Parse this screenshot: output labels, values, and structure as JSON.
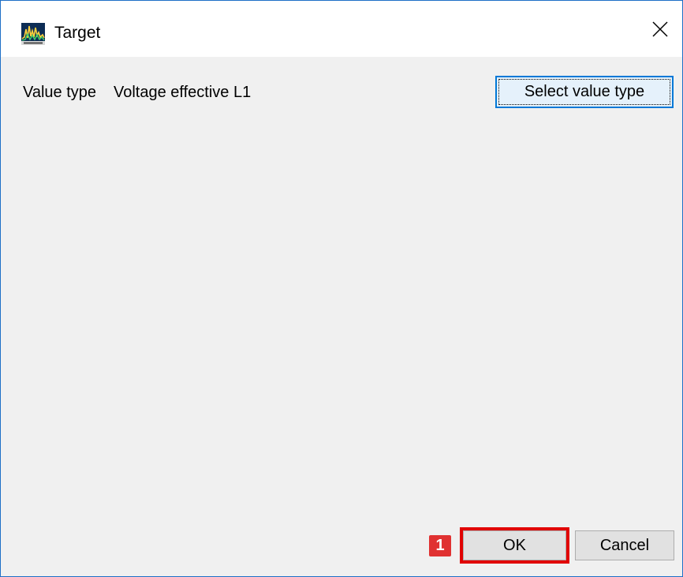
{
  "window": {
    "title": "Target",
    "border_color": "#1e6fc7",
    "close_icon": "close-icon",
    "app_icon": "app-icon"
  },
  "form": {
    "value_type_label": "Value type",
    "value_type_value": "Voltage effective L1",
    "select_button_label": "Select value type"
  },
  "footer": {
    "ok_label": "OK",
    "cancel_label": "Cancel"
  },
  "annotation": {
    "step_number": "1",
    "highlight_color": "#e10000",
    "badge_color": "#e03131"
  }
}
